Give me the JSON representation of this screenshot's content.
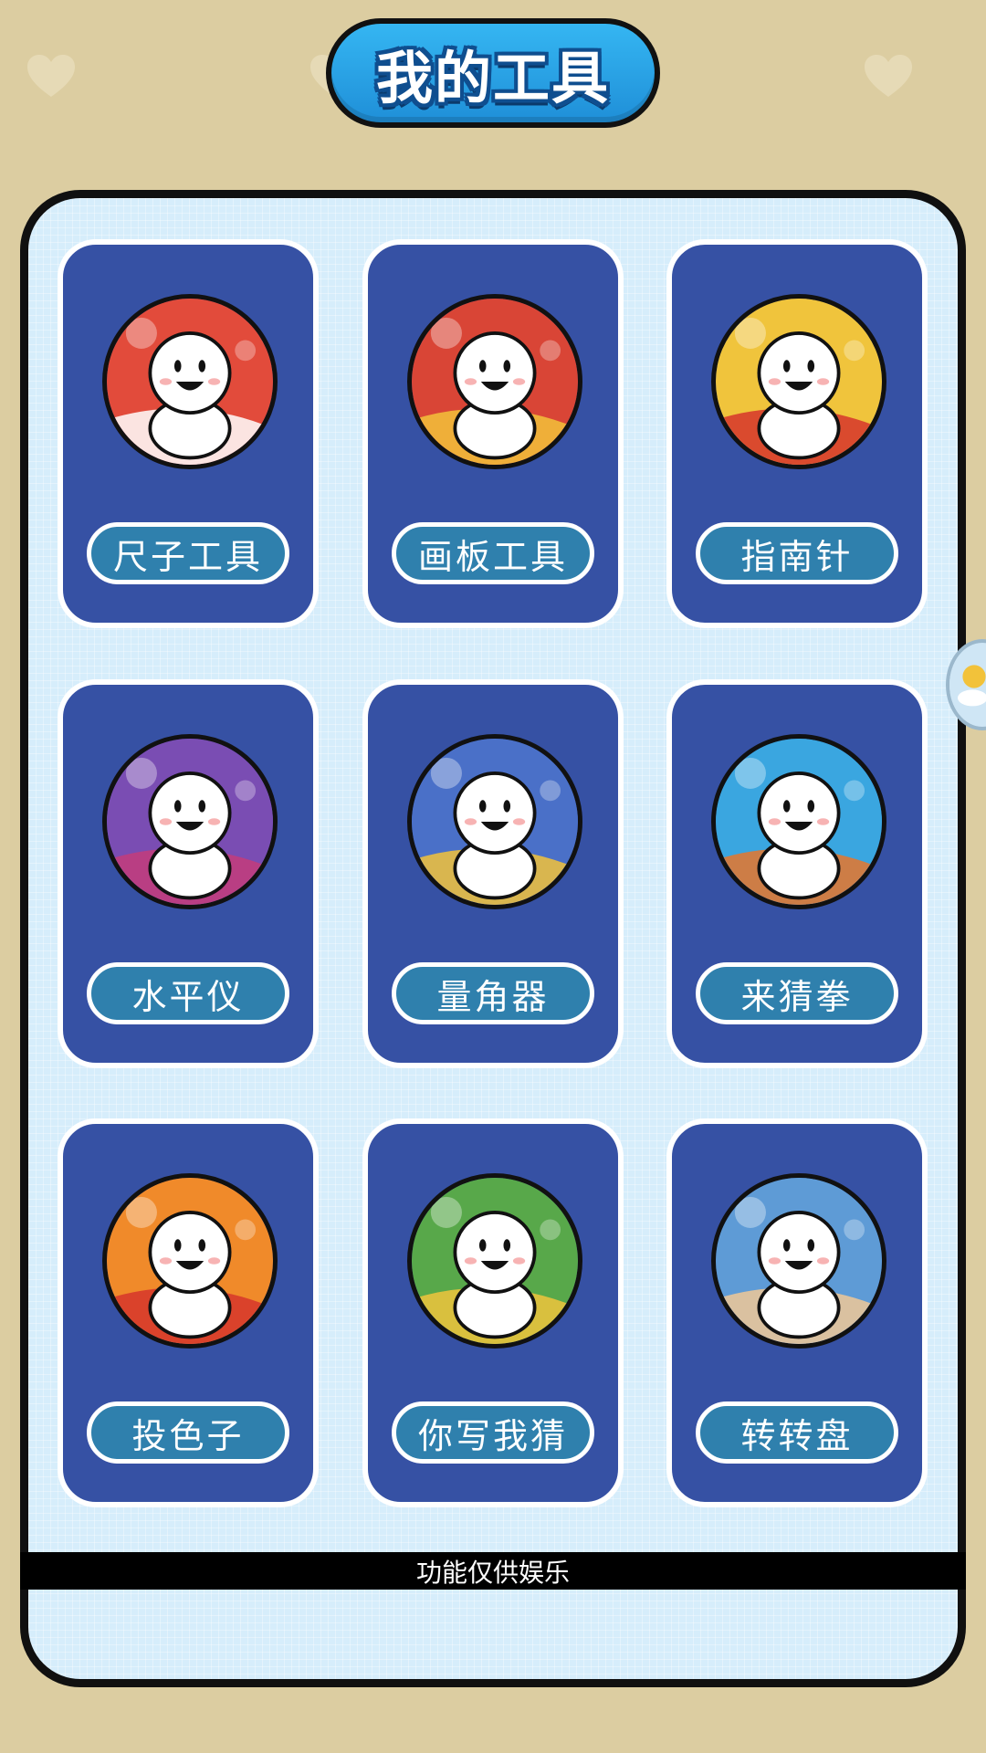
{
  "header": {
    "title": "我的工具"
  },
  "tools": [
    {
      "label": "尺子工具",
      "icon": "avatar-ruler-icon",
      "bg": "#e24b3b",
      "accent": "#ffffff"
    },
    {
      "label": "画板工具",
      "icon": "avatar-drawing-board-icon",
      "bg": "#d94536",
      "accent": "#f2c23a"
    },
    {
      "label": "指南针",
      "icon": "avatar-compass-icon",
      "bg": "#f0c43c",
      "accent": "#d6352b"
    },
    {
      "label": "水平仪",
      "icon": "avatar-level-icon",
      "bg": "#7a4db3",
      "accent": "#c43c7a"
    },
    {
      "label": "量角器",
      "icon": "avatar-protractor-icon",
      "bg": "#4a70c8",
      "accent": "#f2c23a"
    },
    {
      "label": "来猜拳",
      "icon": "avatar-rock-paper-scissors-icon",
      "bg": "#3aa6e0",
      "accent": "#e8752a"
    },
    {
      "label": "投色子",
      "icon": "avatar-dice-icon",
      "bg": "#f08a2a",
      "accent": "#d6352b"
    },
    {
      "label": "你写我猜",
      "icon": "avatar-draw-guess-icon",
      "bg": "#58a84a",
      "accent": "#f0c43c"
    },
    {
      "label": "转转盘",
      "icon": "avatar-spin-wheel-icon",
      "bg": "#5e9bd6",
      "accent": "#f0c896"
    }
  ],
  "footer": {
    "notice": "功能仅供娱乐"
  },
  "colors": {
    "page_bg": "#dccda1",
    "panel_bg": "#d6edfb",
    "card_bg": "#3651a4",
    "label_bg": "#2f80ad",
    "title_bg": "#27a2e6"
  }
}
